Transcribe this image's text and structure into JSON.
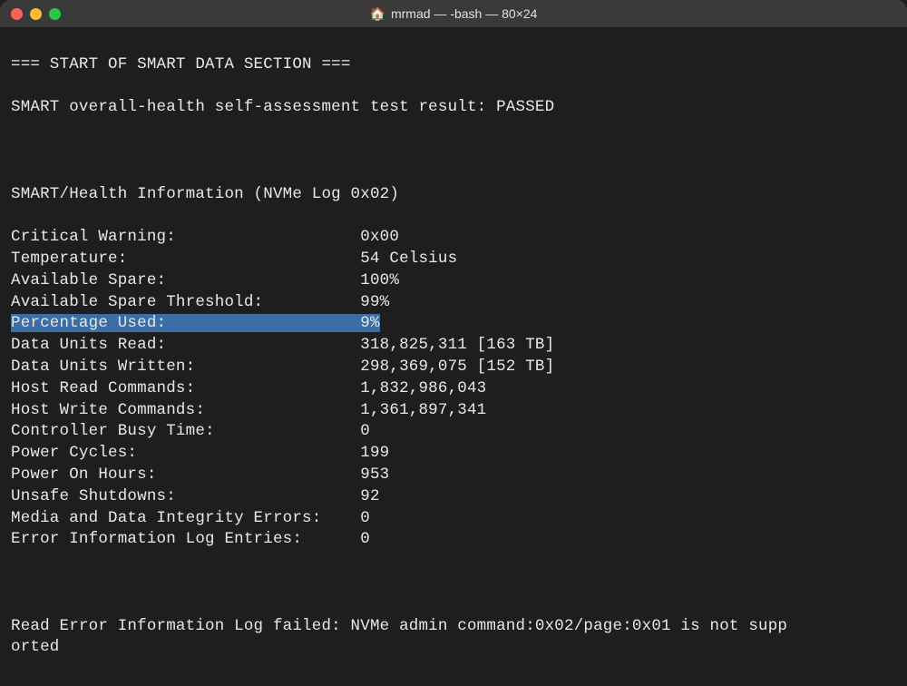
{
  "window": {
    "title": "mrmad — -bash — 80×24"
  },
  "terminal": {
    "section_header": "=== START OF SMART DATA SECTION ===",
    "overall_result": "SMART overall-health self-assessment test result: PASSED",
    "info_header": "SMART/Health Information (NVMe Log 0x02)",
    "rows": [
      {
        "label": "Critical Warning:",
        "value": "0x00",
        "highlighted": false
      },
      {
        "label": "Temperature:",
        "value": "54 Celsius",
        "highlighted": false
      },
      {
        "label": "Available Spare:",
        "value": "100%",
        "highlighted": false
      },
      {
        "label": "Available Spare Threshold:",
        "value": "99%",
        "highlighted": false
      },
      {
        "label": "Percentage Used:",
        "value": "9%",
        "highlighted": true
      },
      {
        "label": "Data Units Read:",
        "value": "318,825,311 [163 TB]",
        "highlighted": false
      },
      {
        "label": "Data Units Written:",
        "value": "298,369,075 [152 TB]",
        "highlighted": false
      },
      {
        "label": "Host Read Commands:",
        "value": "1,832,986,043",
        "highlighted": false
      },
      {
        "label": "Host Write Commands:",
        "value": "1,361,897,341",
        "highlighted": false
      },
      {
        "label": "Controller Busy Time:",
        "value": "0",
        "highlighted": false
      },
      {
        "label": "Power Cycles:",
        "value": "199",
        "highlighted": false
      },
      {
        "label": "Power On Hours:",
        "value": "953",
        "highlighted": false
      },
      {
        "label": "Unsafe Shutdowns:",
        "value": "92",
        "highlighted": false
      },
      {
        "label": "Media and Data Integrity Errors:",
        "value": "0",
        "highlighted": false
      },
      {
        "label": "Error Information Log Entries:",
        "value": "0",
        "highlighted": false
      }
    ],
    "error_line": "Read Error Information Log failed: NVMe admin command:0x02/page:0x01 is not supported"
  }
}
